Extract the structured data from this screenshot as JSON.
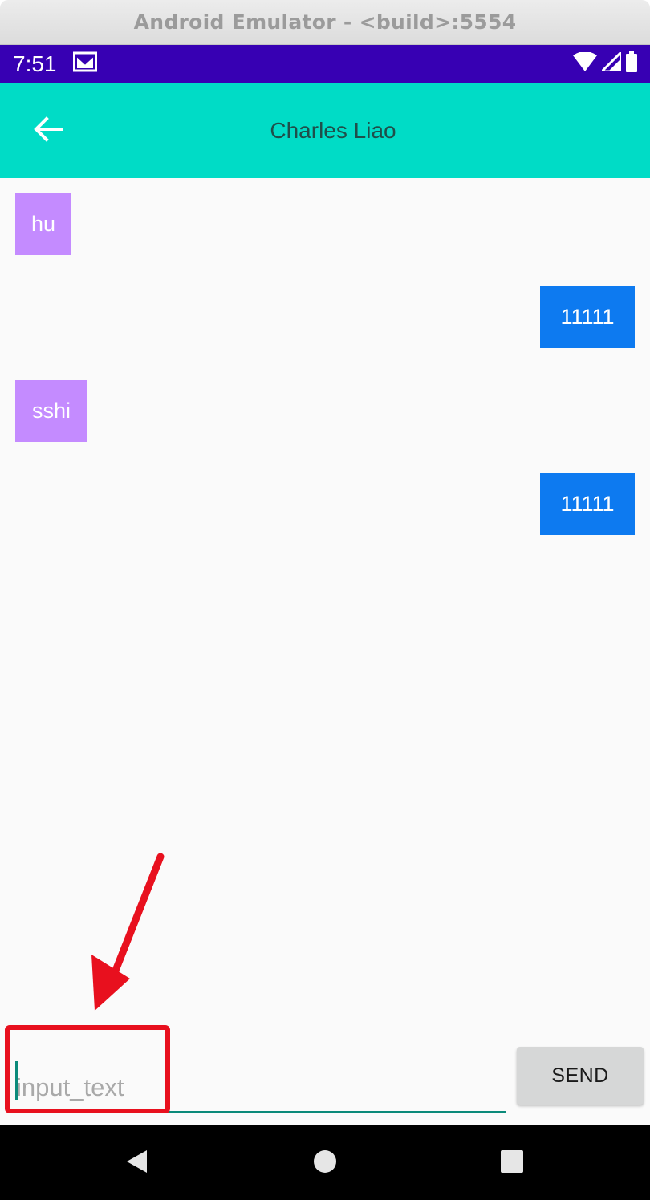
{
  "window": {
    "title": "Android Emulator - <build>:5554"
  },
  "status_bar": {
    "time": "7:51",
    "icons": [
      "gmail-icon",
      "wifi-icon",
      "cell-signal-icon",
      "battery-icon"
    ]
  },
  "app_bar": {
    "title": "Charles Liao",
    "back_icon": "arrow-back-icon"
  },
  "messages": [
    {
      "text": "hu",
      "direction": "received"
    },
    {
      "text": "11111",
      "direction": "sent"
    },
    {
      "text": "sshi",
      "direction": "received"
    },
    {
      "text": "11111",
      "direction": "sent"
    }
  ],
  "composer": {
    "placeholder": "input_text",
    "value": "",
    "send_label": "SEND"
  },
  "nav_bar": {
    "icons": [
      "back-triangle-icon",
      "home-circle-icon",
      "recents-square-icon"
    ]
  },
  "colors": {
    "status_bar": "#3700b3",
    "app_bar": "#00dcc6",
    "received_bubble": "#c48bff",
    "sent_bubble": "#0d7af0",
    "accent": "#0b8a7a",
    "annotation": "#e8101e"
  }
}
